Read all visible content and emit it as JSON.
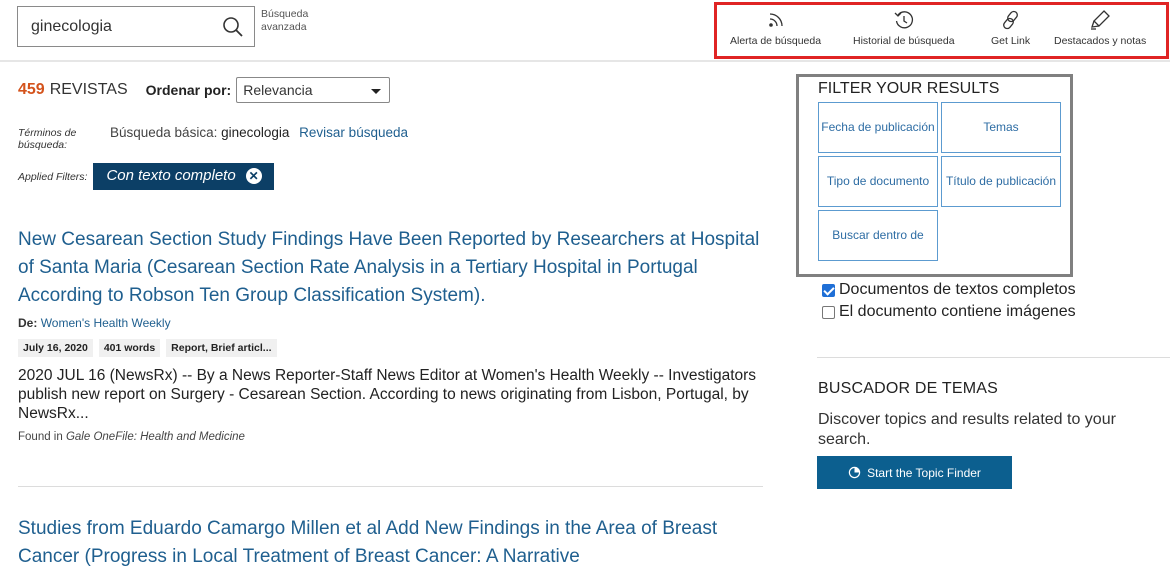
{
  "search": {
    "query": "ginecologia",
    "advanced_label": "Búsqueda avanzada"
  },
  "tools": {
    "alert": "Alerta de búsqueda",
    "history": "Historial de búsqueda",
    "link": "Get Link",
    "highlights": "Destacados y notas"
  },
  "results_header": {
    "count": "459",
    "count_label": "REVISTAS",
    "sort_label": "Ordenar por:",
    "sort_value": "Relevancia"
  },
  "terms": {
    "label": "Términos de búsqueda:",
    "prefix": "Búsqueda básica:",
    "term": "ginecologia",
    "revise": "Revisar búsqueda"
  },
  "applied": {
    "label": "Applied Filters:",
    "chip": "Con texto completo"
  },
  "results": [
    {
      "title": "New Cesarean Section Study Findings Have Been Reported by Researchers at Hospital of Santa Maria (Cesarean Section Rate Analysis in a Tertiary Hospital in Portugal According to Robson Ten Group Classification System).",
      "source_label": "De:",
      "source": "Women's Health Weekly",
      "date": "July 16, 2020",
      "words": "401 words",
      "type": "Report, Brief articl...",
      "snippet": "2020 JUL 16 (NewsRx) -- By a News Reporter-Staff News Editor at Women's Health Weekly -- Investigators publish new report on Surgery - Cesarean Section. According to news originating from Lisbon, Portugal, by NewsRx...",
      "found_prefix": "Found in",
      "found_db": "Gale OneFile: Health and Medicine"
    },
    {
      "title": "Studies from Eduardo Camargo Millen et al Add New Findings in the Area of Breast Cancer (Progress in Local Treatment of Breast Cancer: A Narrative"
    }
  ],
  "filter_panel": {
    "heading": "FILTER YOUR RESULTS",
    "buttons": [
      "Fecha de publicación",
      "Temas",
      "Tipo de documento",
      "Título de publicación",
      "Buscar dentro de"
    ]
  },
  "checkboxes": [
    {
      "label": "Documentos de textos completos",
      "checked": true
    },
    {
      "label": "El documento contiene imágenes",
      "checked": false
    }
  ],
  "topic_finder": {
    "heading": "BUSCADOR DE TEMAS",
    "description": "Discover topics and results related to your search.",
    "button": "Start the Topic Finder"
  },
  "colors": {
    "accent": "#d4531c",
    "link": "#1f5f8f",
    "chip": "#0c3f66",
    "highlight_border": "#e02424",
    "topic_button": "#0c5f8f"
  }
}
